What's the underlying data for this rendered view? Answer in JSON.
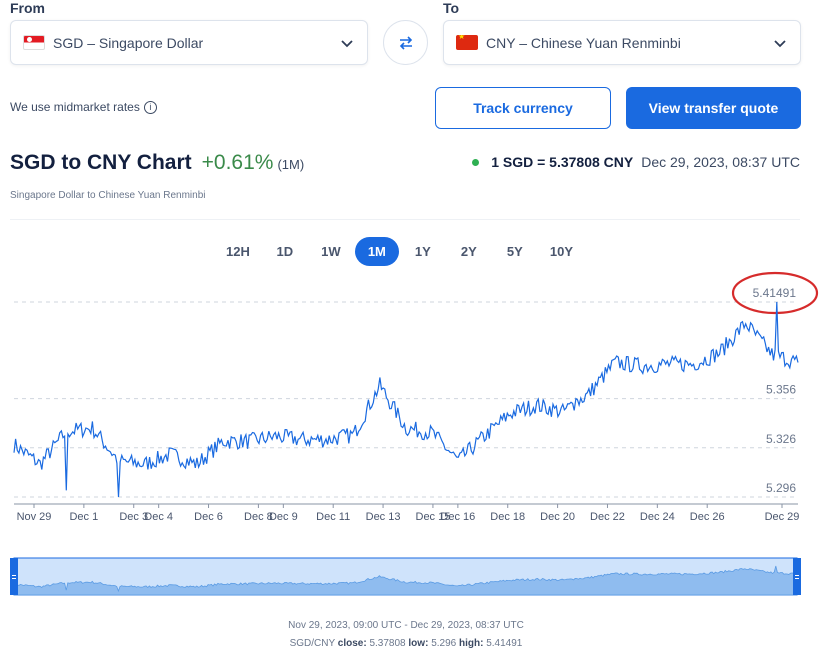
{
  "converter": {
    "from_label": "From",
    "to_label": "To",
    "from_value": "SGD – Singapore Dollar",
    "to_value": "CNY – Chinese Yuan Renminbi",
    "midmarket_text": "We use midmarket rates",
    "track_button": "Track currency",
    "quote_button": "View transfer quote"
  },
  "header": {
    "title": "SGD to CNY Chart",
    "change": "+0.61%",
    "change_period": "(1M)",
    "subtitle": "Singapore Dollar to Chinese Yuan Renminbi",
    "rate": "1 SGD = 5.37808 CNY",
    "timestamp": "Dec 29, 2023, 08:37 UTC",
    "accent_color": "#1a6ae0",
    "positive_color": "#3a8a4a"
  },
  "periods": [
    "12H",
    "1D",
    "1W",
    "1M",
    "1Y",
    "2Y",
    "5Y",
    "10Y"
  ],
  "active_period": "1M",
  "chart_data": {
    "type": "line",
    "series": [
      {
        "x": [
          "Nov 29",
          "Nov 30",
          "Dec 1",
          "Dec 2",
          "Dec 3",
          "Dec 4",
          "Dec 5",
          "Dec 6",
          "Dec 7",
          "Dec 8",
          "Dec 9",
          "Dec 10",
          "Dec 11",
          "Dec 12",
          "Dec 13",
          "Dec 14",
          "Dec 15",
          "Dec 16",
          "Dec 17",
          "Dec 18",
          "Dec 19",
          "Dec 20",
          "Dec 21",
          "Dec 22",
          "Dec 23",
          "Dec 24",
          "Dec 25",
          "Dec 26",
          "Dec 27",
          "Dec 28",
          "Dec 29"
        ],
        "values": [
          5.328,
          5.316,
          5.336,
          5.338,
          5.318,
          5.316,
          5.322,
          5.316,
          5.33,
          5.33,
          5.333,
          5.331,
          5.331,
          5.334,
          5.364,
          5.338,
          5.335,
          5.318,
          5.333,
          5.347,
          5.352,
          5.348,
          5.359,
          5.378,
          5.376,
          5.377,
          5.377,
          5.384,
          5.402,
          5.383,
          5.378
        ]
      }
    ],
    "x_ticks": [
      "Nov 29",
      "Dec 1",
      "Dec 3",
      "Dec 4",
      "Dec 6",
      "Dec 8",
      "Dec 9",
      "Dec 11",
      "Dec 13",
      "Dec 15",
      "Dec 16",
      "Dec 18",
      "Dec 20",
      "Dec 22",
      "Dec 24",
      "Dec 26",
      "Dec 29"
    ],
    "y_ticks": [
      "5.296",
      "5.326",
      "5.356"
    ],
    "high_label": "5.41491",
    "low": 5.296,
    "high": 5.41491,
    "close": 5.37808,
    "ylim": [
      5.296,
      5.41491
    ],
    "grid": "dashed horizontal",
    "line_color": "#1a6ae0",
    "high_marker_color": "#d62b2b"
  },
  "footer": {
    "range": "Nov 29, 2023, 09:00 UTC - Dec 29, 2023, 08:37 UTC",
    "pair": "SGD/CNY",
    "close_label": "close:",
    "close_value": "5.37808",
    "low_label": "low:",
    "low_value": "5.296",
    "high_label": "high:",
    "high_value": "5.41491"
  }
}
